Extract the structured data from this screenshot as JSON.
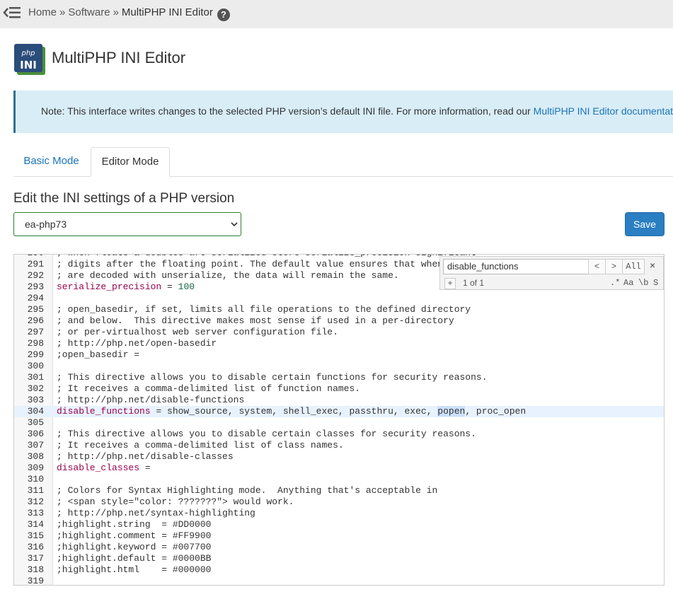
{
  "breadcrumb": {
    "home": "Home",
    "sep": "»",
    "software": "Software",
    "current": "MultiPHP INI Editor",
    "help": "?"
  },
  "page": {
    "title": "MultiPHP INI Editor",
    "icon_text_top": "php",
    "icon_text_bottom": "INI"
  },
  "note": {
    "text": "Note: This interface writes changes to the selected PHP version’s default INI file. For more information, read our ",
    "link": "MultiPHP INI Editor documentation"
  },
  "tabs": [
    {
      "label": "Basic Mode"
    },
    {
      "label": "Editor Mode"
    }
  ],
  "section_title": "Edit the INI settings of a PHP version",
  "version_select": {
    "value": "ea-php73"
  },
  "save_label": "Save",
  "find": {
    "query": "disable_functions",
    "prev": "<",
    "next": ">",
    "all": "All",
    "close": "×",
    "plus": "+",
    "count": "1 of 1",
    "regex": ".*",
    "case": "Aa",
    "word": "\\b",
    "selection": "S"
  },
  "editor": {
    "lines": [
      {
        "n": "290",
        "text": "; When floats & doubles are serialized store serialize_precision significant"
      },
      {
        "n": "291",
        "text": "; digits after the floating point. The default value ensures that when floats"
      },
      {
        "n": "292",
        "text": "; are decoded with unserialize, the data will remain the same."
      },
      {
        "n": "293",
        "key": "serialize_precision",
        "rest": " = ",
        "num": "100"
      },
      {
        "n": "294",
        "text": ""
      },
      {
        "n": "295",
        "text": "; open_basedir, if set, limits all file operations to the defined directory"
      },
      {
        "n": "296",
        "text": "; and below.  This directive makes most sense if used in a per-directory"
      },
      {
        "n": "297",
        "text": "; or per-virtualhost web server configuration file."
      },
      {
        "n": "298",
        "text": "; http://php.net/open-basedir"
      },
      {
        "n": "299",
        "text": ";open_basedir ="
      },
      {
        "n": "300",
        "text": ""
      },
      {
        "n": "301",
        "text": "; This directive allows you to disable certain functions for security reasons."
      },
      {
        "n": "302",
        "text": "; It receives a comma-delimited list of function names."
      },
      {
        "n": "303",
        "text": "; http://php.net/disable-functions"
      },
      {
        "n": "304",
        "key": "disable_functions",
        "rest": " = show_source, system, shell_exec, passthru, exec, ",
        "highlight": "popen",
        "after": ", proc_open",
        "active": true
      },
      {
        "n": "305",
        "text": ""
      },
      {
        "n": "306",
        "text": "; This directive allows you to disable certain classes for security reasons."
      },
      {
        "n": "307",
        "text": "; It receives a comma-delimited list of class names."
      },
      {
        "n": "308",
        "text": "; http://php.net/disable-classes"
      },
      {
        "n": "309",
        "key": "disable_classes",
        "rest": " ="
      },
      {
        "n": "310",
        "text": ""
      },
      {
        "n": "311",
        "text": "; Colors for Syntax Highlighting mode.  Anything that's acceptable in"
      },
      {
        "n": "312",
        "text": "; <span style=\"color: ???????\"> would work."
      },
      {
        "n": "313",
        "text": "; http://php.net/syntax-highlighting"
      },
      {
        "n": "314",
        "text": ";highlight.string  = #DD0000"
      },
      {
        "n": "315",
        "text": ";highlight.comment = #FF9900"
      },
      {
        "n": "316",
        "text": ";highlight.keyword = #007700"
      },
      {
        "n": "317",
        "text": ";highlight.default = #0000BB"
      },
      {
        "n": "318",
        "text": ";highlight.html    = #000000"
      },
      {
        "n": "319",
        "text": ""
      }
    ]
  }
}
